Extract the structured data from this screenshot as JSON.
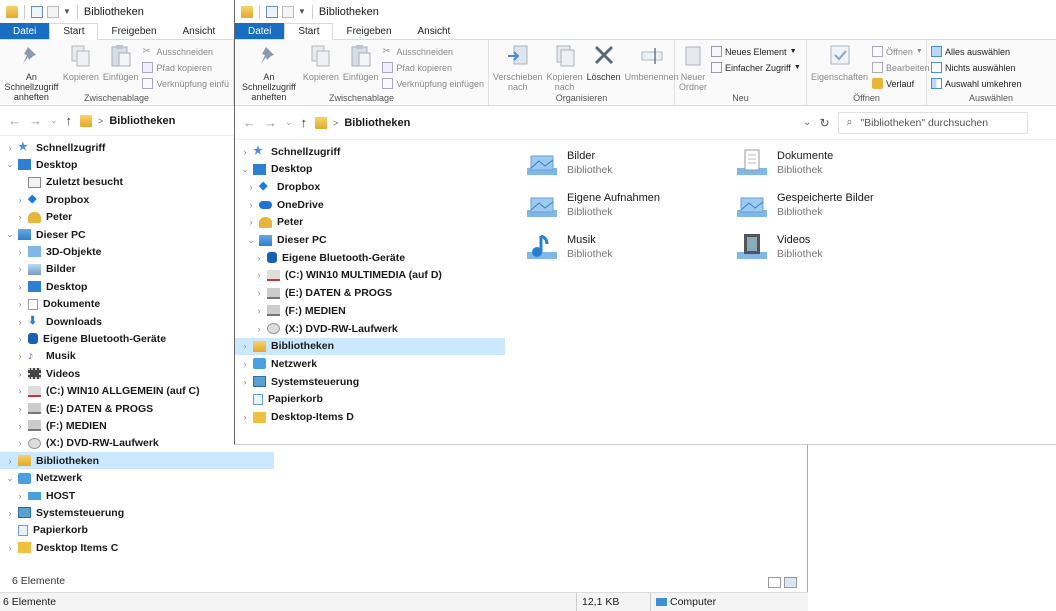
{
  "back_window": {
    "title": "Bibliotheken",
    "tabs": [
      "Datei",
      "Start",
      "Freigeben",
      "Ansicht"
    ],
    "ribbon": {
      "pin_label_1": "An Schnellzugriff",
      "pin_label_2": "anheften",
      "copy": "Kopieren",
      "paste": "Einfügen",
      "cut": "Ausschneiden",
      "copy_path": "Pfad kopieren",
      "paste_link": "Verknüpfung einfü",
      "group_clipboard": "Zwischenablage"
    },
    "breadcrumb": "Bibliotheken",
    "tree": [
      {
        "label": "Schnellzugriff",
        "chev": ">",
        "icon": "star-icon"
      },
      {
        "label": "Desktop",
        "chev": "v",
        "icon": "desktop-icon"
      },
      {
        "label": "Zuletzt besucht",
        "chev": "",
        "icon": "recent-icon"
      },
      {
        "label": "Dropbox",
        "chev": ">",
        "icon": "dropbox-icon"
      },
      {
        "label": "Peter",
        "chev": ">",
        "icon": "user-icon"
      },
      {
        "label": "Dieser PC",
        "chev": "v",
        "icon": "pc-icon"
      },
      {
        "label": "3D-Objekte",
        "chev": ">",
        "icon": "cube-icon"
      },
      {
        "label": "Bilder",
        "chev": ">",
        "icon": "pictures-icon"
      },
      {
        "label": "Desktop",
        "chev": ">",
        "icon": "desktop-icon"
      },
      {
        "label": "Dokumente",
        "chev": ">",
        "icon": "document-icon"
      },
      {
        "label": "Downloads",
        "chev": ">",
        "icon": "download-icon"
      },
      {
        "label": "Eigene Bluetooth-Geräte",
        "chev": ">",
        "icon": "bluetooth-icon"
      },
      {
        "label": "Musik",
        "chev": ">",
        "icon": "music-icon"
      },
      {
        "label": "Videos",
        "chev": ">",
        "icon": "video-icon"
      },
      {
        "label": "(C:) WIN10 ALLGEMEIN (auf C)",
        "chev": ">",
        "icon": "drive-icon"
      },
      {
        "label": "(E:) DATEN & PROGS",
        "chev": ">",
        "icon": "network-drive-icon"
      },
      {
        "label": "(F:) MEDIEN",
        "chev": ">",
        "icon": "network-drive-icon"
      },
      {
        "label": "(X:) DVD-RW-Laufwerk",
        "chev": ">",
        "icon": "dvd-drive-icon"
      },
      {
        "label": "Bibliotheken",
        "chev": ">",
        "icon": "library-icon"
      },
      {
        "label": "Netzwerk",
        "chev": "v",
        "icon": "network-icon"
      },
      {
        "label": "HOST",
        "chev": ">",
        "icon": "computer-icon"
      },
      {
        "label": "Systemsteuerung",
        "chev": ">",
        "icon": "control-panel-icon"
      },
      {
        "label": "Papierkorb",
        "chev": "",
        "icon": "recycle-bin-icon"
      },
      {
        "label": "Desktop Items C",
        "chev": ">",
        "icon": "folder-icon"
      }
    ],
    "status_count": "6 Elemente"
  },
  "bottom_status": {
    "count": "6 Elemente",
    "size": "12,1 KB",
    "location": "Computer"
  },
  "front_window": {
    "title": "Bibliotheken",
    "tabs": [
      "Datei",
      "Start",
      "Freigeben",
      "Ansicht"
    ],
    "ribbon": {
      "pin_label_1": "An Schnellzugriff",
      "pin_label_2": "anheften",
      "copy": "Kopieren",
      "paste": "Einfügen",
      "cut": "Ausschneiden",
      "copy_path": "Pfad kopieren",
      "paste_link": "Verknüpfung einfügen",
      "group_clipboard": "Zwischenablage",
      "move_1": "Verschieben",
      "move_2": "nach",
      "copyto_1": "Kopieren",
      "copyto_2": "nach",
      "delete": "Löschen",
      "rename": "Umbenennen",
      "group_organize": "Organisieren",
      "new_folder_1": "Neuer",
      "new_folder_2": "Ordner",
      "new_item": "Neues Element",
      "easy_access": "Einfacher Zugriff",
      "group_new": "Neu",
      "properties": "Eigenschaften",
      "open": "Öffnen",
      "edit": "Bearbeiten",
      "history": "Verlauf",
      "group_open": "Öffnen",
      "select_all": "Alles auswählen",
      "select_none": "Nichts auswählen",
      "invert_selection": "Auswahl umkehren",
      "group_select": "Auswählen"
    },
    "breadcrumb": "Bibliotheken",
    "search_placeholder": "\"Bibliotheken\" durchsuchen",
    "tree": [
      {
        "label": "Schnellzugriff",
        "chev": ">",
        "icon": "star-icon"
      },
      {
        "label": "Desktop",
        "chev": "v",
        "icon": "desktop-icon"
      },
      {
        "label": "Dropbox",
        "chev": ">",
        "icon": "dropbox-icon"
      },
      {
        "label": "OneDrive",
        "chev": ">",
        "icon": "cloud-icon"
      },
      {
        "label": "Peter",
        "chev": ">",
        "icon": "user-icon"
      },
      {
        "label": "Dieser PC",
        "chev": "v",
        "icon": "pc-icon"
      },
      {
        "label": "Eigene Bluetooth-Geräte",
        "chev": ">",
        "icon": "bluetooth-icon"
      },
      {
        "label": "(C:) WIN10 MULTIMEDIA (auf D)",
        "chev": ">",
        "icon": "drive-icon"
      },
      {
        "label": "(E:) DATEN & PROGS",
        "chev": ">",
        "icon": "network-drive-icon"
      },
      {
        "label": "(F:) MEDIEN",
        "chev": ">",
        "icon": "network-drive-icon"
      },
      {
        "label": "(X:) DVD-RW-Laufwerk",
        "chev": ">",
        "icon": "dvd-drive-icon"
      },
      {
        "label": "Bibliotheken",
        "chev": ">",
        "icon": "library-icon"
      },
      {
        "label": "Netzwerk",
        "chev": ">",
        "icon": "network-icon"
      },
      {
        "label": "Systemsteuerung",
        "chev": ">",
        "icon": "control-panel-icon"
      },
      {
        "label": "Papierkorb",
        "chev": "",
        "icon": "recycle-bin-icon"
      },
      {
        "label": "Desktop-Items D",
        "chev": ">",
        "icon": "folder-icon"
      }
    ],
    "libraries": [
      {
        "name": "Bilder",
        "type": "Bibliothek",
        "icon": "pictures-library-icon"
      },
      {
        "name": "Dokumente",
        "type": "Bibliothek",
        "icon": "documents-library-icon"
      },
      {
        "name": "Eigene Aufnahmen",
        "type": "Bibliothek",
        "icon": "pictures-library-icon"
      },
      {
        "name": "Gespeicherte Bilder",
        "type": "Bibliothek",
        "icon": "pictures-library-icon"
      },
      {
        "name": "Musik",
        "type": "Bibliothek",
        "icon": "music-library-icon"
      },
      {
        "name": "Videos",
        "type": "Bibliothek",
        "icon": "videos-library-icon"
      }
    ]
  },
  "colors": {
    "accent": "#1a6ec1",
    "selection": "#cce8ff",
    "folder": "#e8b53a"
  }
}
